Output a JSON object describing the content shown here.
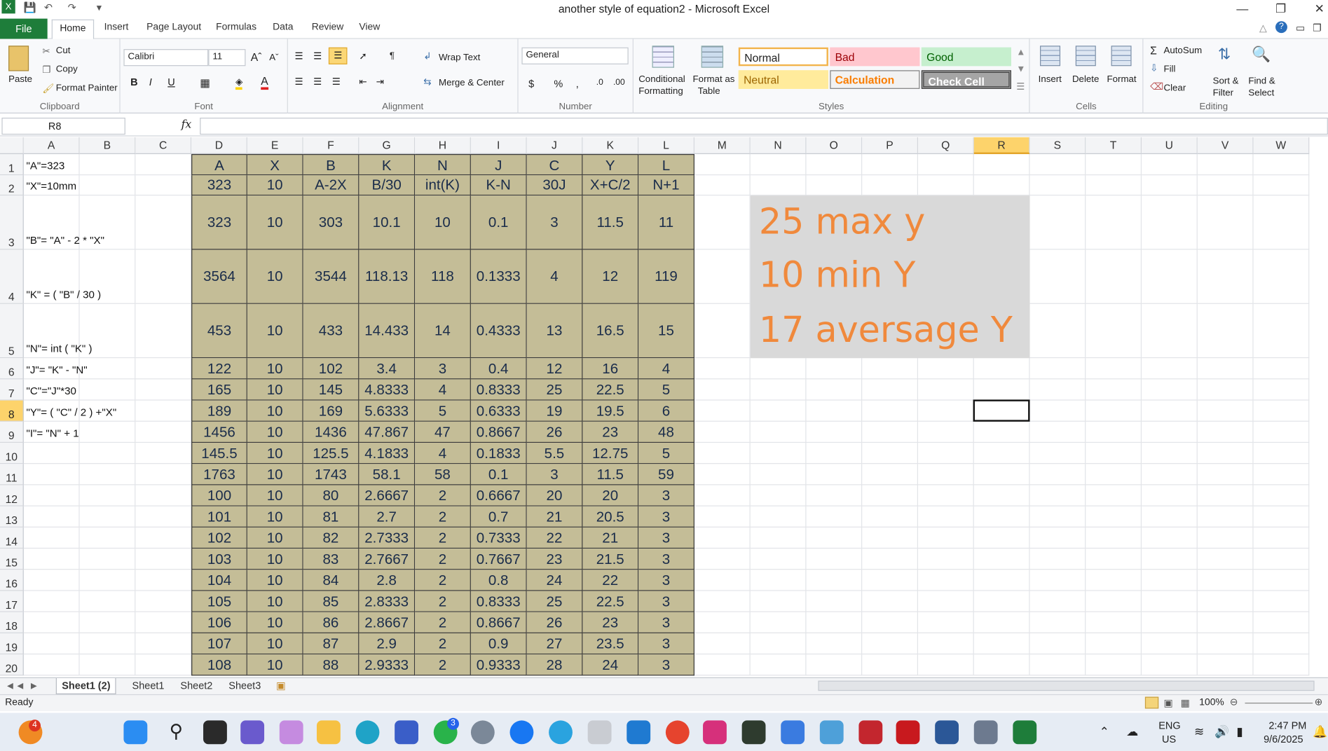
{
  "titlebar": {
    "title": "another style of equation2 - Microsoft Excel"
  },
  "tabs": {
    "file": "File",
    "home": "Home",
    "items": [
      "Insert",
      "Page Layout",
      "Formulas",
      "Data",
      "Review",
      "View"
    ]
  },
  "ribbon": {
    "clipboard": {
      "label": "Clipboard",
      "paste": "Paste",
      "cut": "Cut",
      "copy": "Copy",
      "painter": "Format Painter"
    },
    "font": {
      "label": "Font",
      "name": "Calibri",
      "size": "11"
    },
    "alignment": {
      "label": "Alignment",
      "wrap": "Wrap Text",
      "merge": "Merge & Center"
    },
    "number": {
      "label": "Number",
      "format": "General",
      "currency": "$",
      "percent": "%",
      "comma": ","
    },
    "styles": {
      "label": "Styles",
      "cond": "Conditional",
      "cond2": "Formatting",
      "fat": "Format as",
      "fat2": "Table",
      "normal": "Normal",
      "bad": "Bad",
      "good": "Good",
      "neutral": "Neutral",
      "calc": "Calculation",
      "check": "Check Cell"
    },
    "cells": {
      "label": "Cells",
      "insert": "Insert",
      "delete": "Delete",
      "format": "Format"
    },
    "editing": {
      "label": "Editing",
      "autosum": "AutoSum",
      "fill": "Fill",
      "clear": "Clear",
      "sort": "Sort &",
      "sort2": "Filter",
      "find": "Find &",
      "find2": "Select"
    }
  },
  "formula": {
    "namebox": "R8",
    "fx": "fx",
    "value": ""
  },
  "columns": [
    "A",
    "B",
    "C",
    "D",
    "E",
    "F",
    "G",
    "H",
    "I",
    "J",
    "K",
    "L",
    "M",
    "N",
    "O",
    "P",
    "Q",
    "R",
    "S",
    "T",
    "U",
    "V",
    "W"
  ],
  "rows": [
    "1",
    "2",
    "3",
    "4",
    "5",
    "6",
    "7",
    "8",
    "9",
    "10",
    "11",
    "12",
    "13",
    "14",
    "15",
    "16",
    "17",
    "18",
    "19",
    "20"
  ],
  "colA": [
    "\"A\"=323",
    "\"X\"=10mm",
    "\"B\"= \"A\" - 2 * \"X\"",
    "\"K\" = ( \"B\" / 30 )",
    "\"N\"= int ( \"K\" )",
    "\"J\"= \"K\" - \"N\"",
    "\"C\"=\"J\"*30",
    "\"Y\"= ( \"C\" / 2 ) +\"X\"",
    "\"I\"= \"N\" + 1"
  ],
  "table": [
    [
      "A",
      "X",
      "B",
      "K",
      "N",
      "J",
      "C",
      "Y",
      "L"
    ],
    [
      "323",
      "10",
      "A-2X",
      "B/30",
      "int(K)",
      "K-N",
      "30J",
      "X+C/2",
      "N+1"
    ],
    [
      "323",
      "10",
      "303",
      "10.1",
      "10",
      "0.1",
      "3",
      "11.5",
      "11"
    ],
    [
      "3564",
      "10",
      "3544",
      "118.13",
      "118",
      "0.1333",
      "4",
      "12",
      "119"
    ],
    [
      "453",
      "10",
      "433",
      "14.433",
      "14",
      "0.4333",
      "13",
      "16.5",
      "15"
    ],
    [
      "122",
      "10",
      "102",
      "3.4",
      "3",
      "0.4",
      "12",
      "16",
      "4"
    ],
    [
      "165",
      "10",
      "145",
      "4.8333",
      "4",
      "0.8333",
      "25",
      "22.5",
      "5"
    ],
    [
      "189",
      "10",
      "169",
      "5.6333",
      "5",
      "0.6333",
      "19",
      "19.5",
      "6"
    ],
    [
      "1456",
      "10",
      "1436",
      "47.867",
      "47",
      "0.8667",
      "26",
      "23",
      "48"
    ],
    [
      "145.5",
      "10",
      "125.5",
      "4.1833",
      "4",
      "0.1833",
      "5.5",
      "12.75",
      "5"
    ],
    [
      "1763",
      "10",
      "1743",
      "58.1",
      "58",
      "0.1",
      "3",
      "11.5",
      "59"
    ],
    [
      "100",
      "10",
      "80",
      "2.6667",
      "2",
      "0.6667",
      "20",
      "20",
      "3"
    ],
    [
      "101",
      "10",
      "81",
      "2.7",
      "2",
      "0.7",
      "21",
      "20.5",
      "3"
    ],
    [
      "102",
      "10",
      "82",
      "2.7333",
      "2",
      "0.7333",
      "22",
      "21",
      "3"
    ],
    [
      "103",
      "10",
      "83",
      "2.7667",
      "2",
      "0.7667",
      "23",
      "21.5",
      "3"
    ],
    [
      "104",
      "10",
      "84",
      "2.8",
      "2",
      "0.8",
      "24",
      "22",
      "3"
    ],
    [
      "105",
      "10",
      "85",
      "2.8333",
      "2",
      "0.8333",
      "25",
      "22.5",
      "3"
    ],
    [
      "106",
      "10",
      "86",
      "2.8667",
      "2",
      "0.8667",
      "26",
      "23",
      "3"
    ],
    [
      "107",
      "10",
      "87",
      "2.9",
      "2",
      "0.9",
      "27",
      "23.5",
      "3"
    ],
    [
      "108",
      "10",
      "88",
      "2.9333",
      "2",
      "0.9333",
      "28",
      "24",
      "3"
    ]
  ],
  "summary": [
    "25 max y",
    "10 min Y",
    "17 aversage Y"
  ],
  "sheets": {
    "active": "Sheet1 (2)",
    "others": [
      "Sheet1",
      "Sheet2",
      "Sheet3"
    ]
  },
  "status": {
    "ready": "Ready",
    "zoom": "100%"
  },
  "taskbar": {
    "lang1": "ENG",
    "lang2": "US",
    "time": "2:47 PM",
    "date": "9/6/2025",
    "badge1": "4",
    "badge2": "3"
  }
}
